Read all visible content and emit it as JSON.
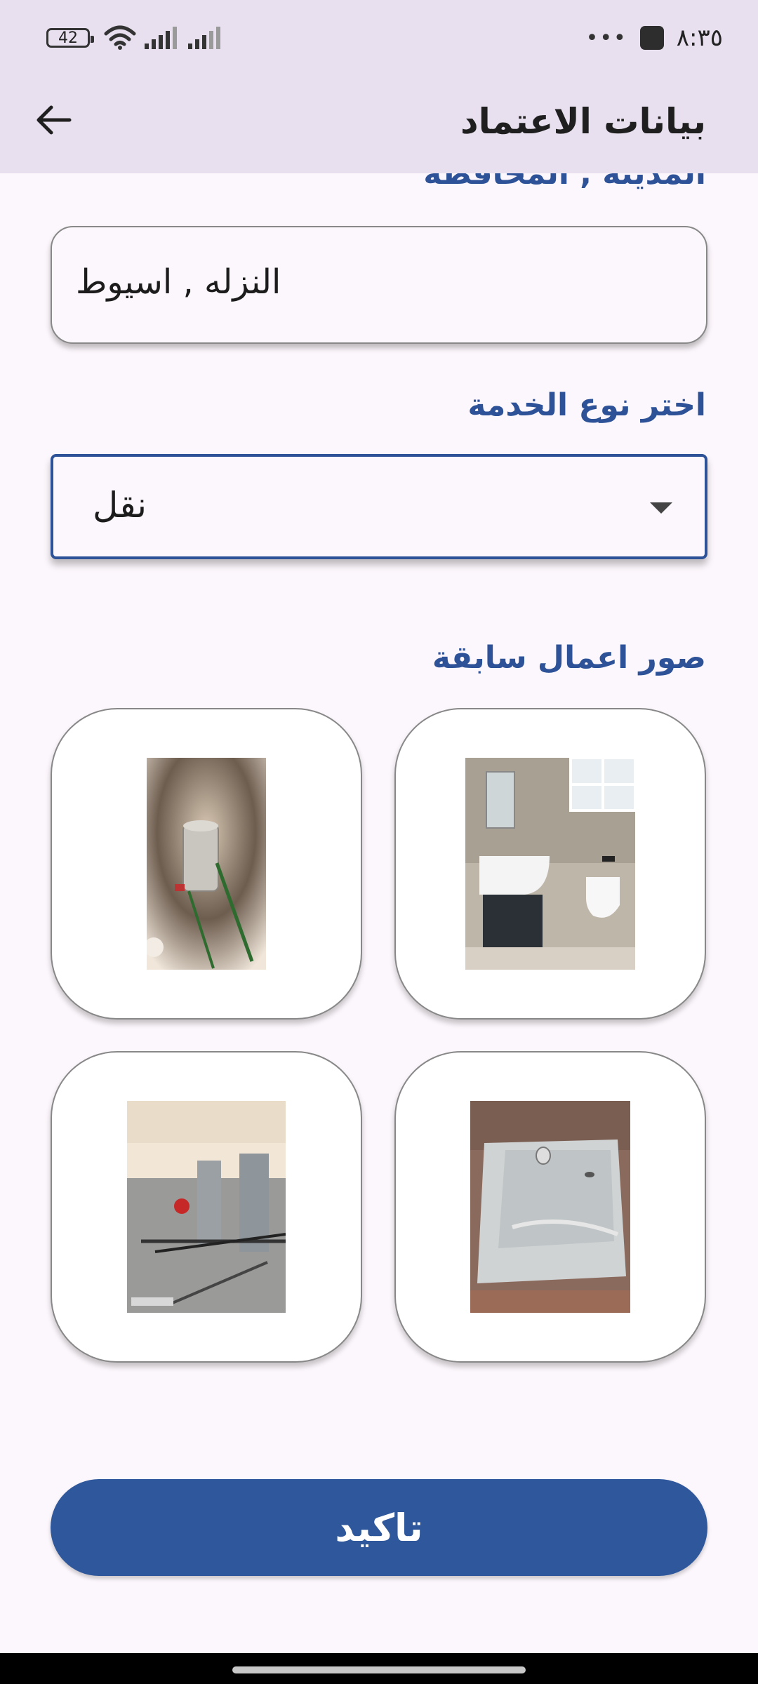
{
  "status_bar": {
    "battery": "42",
    "time": "٨:٣٥",
    "icons": [
      "battery-icon",
      "wifi-icon",
      "signal-icon",
      "signal-icon",
      "more-icon",
      "notification-icon"
    ]
  },
  "app_bar": {
    "title": "بيانات الاعتماد",
    "back_icon": "arrow-left-icon"
  },
  "form": {
    "city_label": "المدينه , المحافظه",
    "city_value": "النزله , اسيوط",
    "service_label": "اختر نوع الخدمة",
    "service_value": "نقل",
    "photos_label": "صور اعمال سابقة"
  },
  "photos": [
    {
      "name": "water-tank-photo"
    },
    {
      "name": "bathroom-photo"
    },
    {
      "name": "rooftop-pipes-photo"
    },
    {
      "name": "waterproofed-floor-photo"
    }
  ],
  "confirm_label": "تاكيد",
  "colors": {
    "accent": "#2e5297",
    "button": "#2f579b",
    "app_bar_bg": "#e8e0ee",
    "page_bg": "#fcf7fc"
  }
}
